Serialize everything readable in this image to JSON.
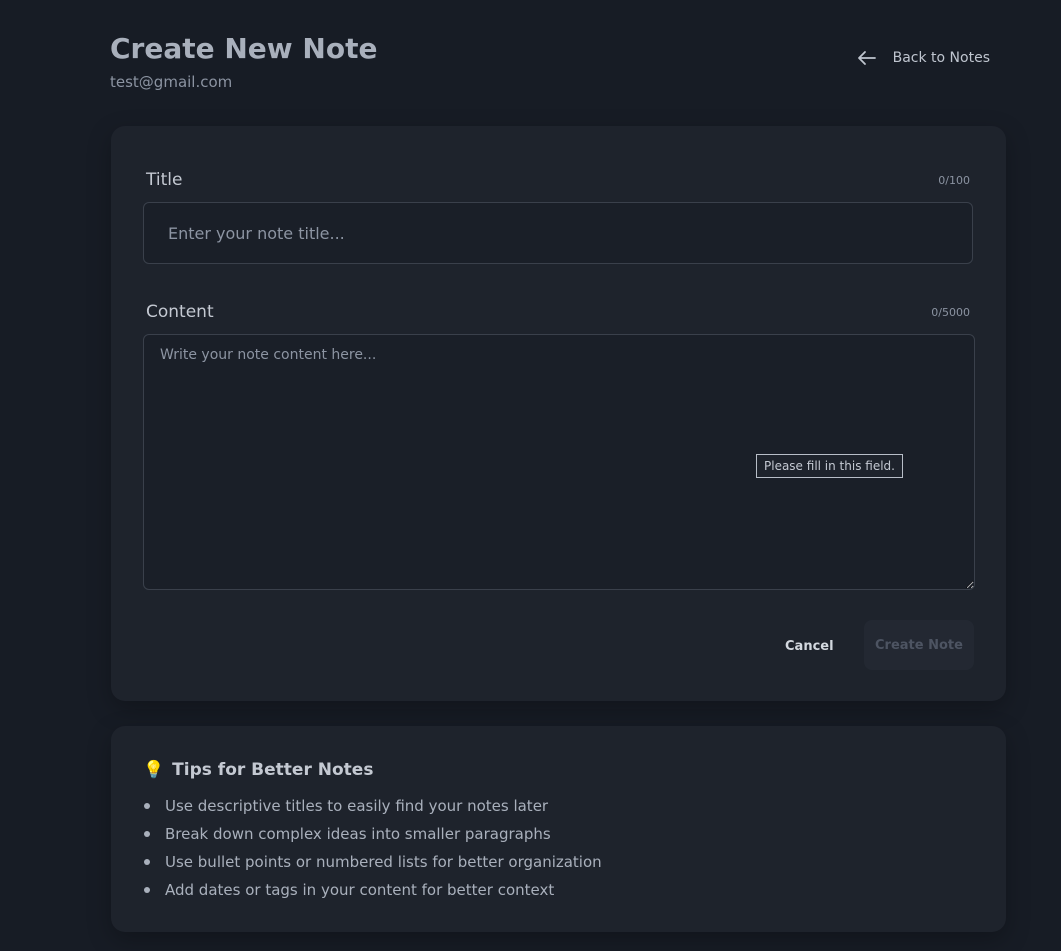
{
  "header": {
    "title": "Create New Note",
    "user_email": "test@gmail.com",
    "back_label": "Back to Notes",
    "back_icon": "arrow-left-icon"
  },
  "form": {
    "title_label": "Title",
    "title_counter": "0/100",
    "title_placeholder": "Enter your note title...",
    "title_value": "",
    "content_label": "Content",
    "content_counter": "0/5000",
    "content_placeholder": "Write your note content here...",
    "content_value": "",
    "validation_tooltip": "Please fill in this field.",
    "cancel_label": "Cancel",
    "create_label": "Create Note",
    "create_disabled": true
  },
  "tips": {
    "icon": "lightbulb-icon",
    "title": "Tips for Better Notes",
    "items": [
      "Use descriptive titles to easily find your notes later",
      "Break down complex ideas into smaller paragraphs",
      "Use bullet points or numbered lists for better organization",
      "Add dates or tags in your content for better context"
    ]
  },
  "colors": {
    "background": "#171c25",
    "card": "#1e232c",
    "border": "#3a404b",
    "text_primary": "#c4c9d2",
    "text_muted": "#8b93a1",
    "button_disabled_bg": "#232832",
    "button_disabled_text": "#4d5462"
  }
}
